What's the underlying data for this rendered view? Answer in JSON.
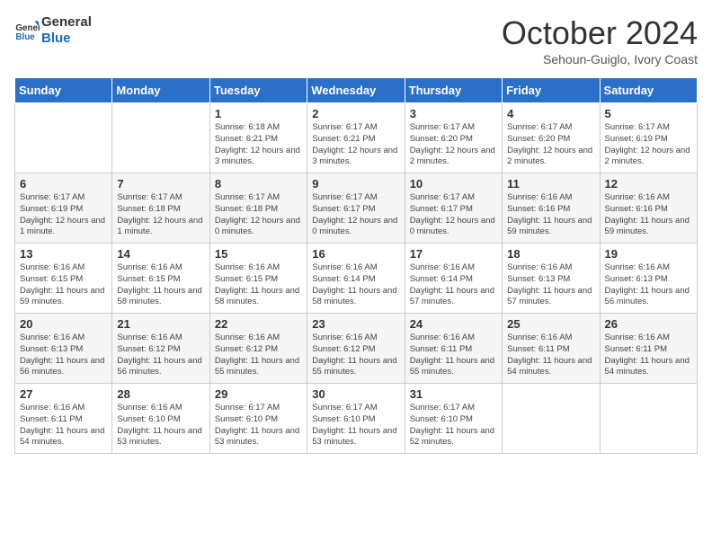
{
  "header": {
    "logo_line1": "General",
    "logo_line2": "Blue",
    "month": "October 2024",
    "location": "Sehoun-Guiglo, Ivory Coast"
  },
  "days_of_week": [
    "Sunday",
    "Monday",
    "Tuesday",
    "Wednesday",
    "Thursday",
    "Friday",
    "Saturday"
  ],
  "weeks": [
    [
      {
        "day": "",
        "info": ""
      },
      {
        "day": "",
        "info": ""
      },
      {
        "day": "1",
        "info": "Sunrise: 6:18 AM\nSunset: 6:21 PM\nDaylight: 12 hours\nand 3 minutes."
      },
      {
        "day": "2",
        "info": "Sunrise: 6:17 AM\nSunset: 6:21 PM\nDaylight: 12 hours\nand 3 minutes."
      },
      {
        "day": "3",
        "info": "Sunrise: 6:17 AM\nSunset: 6:20 PM\nDaylight: 12 hours\nand 2 minutes."
      },
      {
        "day": "4",
        "info": "Sunrise: 6:17 AM\nSunset: 6:20 PM\nDaylight: 12 hours\nand 2 minutes."
      },
      {
        "day": "5",
        "info": "Sunrise: 6:17 AM\nSunset: 6:19 PM\nDaylight: 12 hours\nand 2 minutes."
      }
    ],
    [
      {
        "day": "6",
        "info": "Sunrise: 6:17 AM\nSunset: 6:19 PM\nDaylight: 12 hours\nand 1 minute."
      },
      {
        "day": "7",
        "info": "Sunrise: 6:17 AM\nSunset: 6:18 PM\nDaylight: 12 hours\nand 1 minute."
      },
      {
        "day": "8",
        "info": "Sunrise: 6:17 AM\nSunset: 6:18 PM\nDaylight: 12 hours\nand 0 minutes."
      },
      {
        "day": "9",
        "info": "Sunrise: 6:17 AM\nSunset: 6:17 PM\nDaylight: 12 hours\nand 0 minutes."
      },
      {
        "day": "10",
        "info": "Sunrise: 6:17 AM\nSunset: 6:17 PM\nDaylight: 12 hours\nand 0 minutes."
      },
      {
        "day": "11",
        "info": "Sunrise: 6:16 AM\nSunset: 6:16 PM\nDaylight: 11 hours\nand 59 minutes."
      },
      {
        "day": "12",
        "info": "Sunrise: 6:16 AM\nSunset: 6:16 PM\nDaylight: 11 hours\nand 59 minutes."
      }
    ],
    [
      {
        "day": "13",
        "info": "Sunrise: 6:16 AM\nSunset: 6:15 PM\nDaylight: 11 hours\nand 59 minutes."
      },
      {
        "day": "14",
        "info": "Sunrise: 6:16 AM\nSunset: 6:15 PM\nDaylight: 11 hours\nand 58 minutes."
      },
      {
        "day": "15",
        "info": "Sunrise: 6:16 AM\nSunset: 6:15 PM\nDaylight: 11 hours\nand 58 minutes."
      },
      {
        "day": "16",
        "info": "Sunrise: 6:16 AM\nSunset: 6:14 PM\nDaylight: 11 hours\nand 58 minutes."
      },
      {
        "day": "17",
        "info": "Sunrise: 6:16 AM\nSunset: 6:14 PM\nDaylight: 11 hours\nand 57 minutes."
      },
      {
        "day": "18",
        "info": "Sunrise: 6:16 AM\nSunset: 6:13 PM\nDaylight: 11 hours\nand 57 minutes."
      },
      {
        "day": "19",
        "info": "Sunrise: 6:16 AM\nSunset: 6:13 PM\nDaylight: 11 hours\nand 56 minutes."
      }
    ],
    [
      {
        "day": "20",
        "info": "Sunrise: 6:16 AM\nSunset: 6:13 PM\nDaylight: 11 hours\nand 56 minutes."
      },
      {
        "day": "21",
        "info": "Sunrise: 6:16 AM\nSunset: 6:12 PM\nDaylight: 11 hours\nand 56 minutes."
      },
      {
        "day": "22",
        "info": "Sunrise: 6:16 AM\nSunset: 6:12 PM\nDaylight: 11 hours\nand 55 minutes."
      },
      {
        "day": "23",
        "info": "Sunrise: 6:16 AM\nSunset: 6:12 PM\nDaylight: 11 hours\nand 55 minutes."
      },
      {
        "day": "24",
        "info": "Sunrise: 6:16 AM\nSunset: 6:11 PM\nDaylight: 11 hours\nand 55 minutes."
      },
      {
        "day": "25",
        "info": "Sunrise: 6:16 AM\nSunset: 6:11 PM\nDaylight: 11 hours\nand 54 minutes."
      },
      {
        "day": "26",
        "info": "Sunrise: 6:16 AM\nSunset: 6:11 PM\nDaylight: 11 hours\nand 54 minutes."
      }
    ],
    [
      {
        "day": "27",
        "info": "Sunrise: 6:16 AM\nSunset: 6:11 PM\nDaylight: 11 hours\nand 54 minutes."
      },
      {
        "day": "28",
        "info": "Sunrise: 6:16 AM\nSunset: 6:10 PM\nDaylight: 11 hours\nand 53 minutes."
      },
      {
        "day": "29",
        "info": "Sunrise: 6:17 AM\nSunset: 6:10 PM\nDaylight: 11 hours\nand 53 minutes."
      },
      {
        "day": "30",
        "info": "Sunrise: 6:17 AM\nSunset: 6:10 PM\nDaylight: 11 hours\nand 53 minutes."
      },
      {
        "day": "31",
        "info": "Sunrise: 6:17 AM\nSunset: 6:10 PM\nDaylight: 11 hours\nand 52 minutes."
      },
      {
        "day": "",
        "info": ""
      },
      {
        "day": "",
        "info": ""
      }
    ]
  ]
}
